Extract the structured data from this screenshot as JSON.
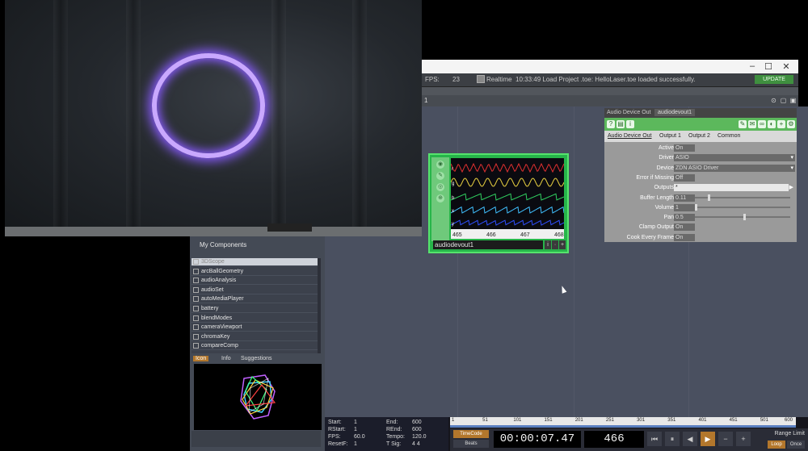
{
  "statusbar": {
    "fps_label": "FPS:",
    "fps_value": "23",
    "realtime_label": "Realtime",
    "message": "10:33:49 Load Project .toe: HelloLaser.toe loaded successfully.",
    "update_label": "UPDATE"
  },
  "window": {
    "minimize": "–",
    "maximize": "☐",
    "close": "✕"
  },
  "pathbar": {
    "label": "1"
  },
  "node": {
    "name": "audiodevout1",
    "ruler": [
      "465",
      "466",
      "467",
      "468"
    ],
    "channel_labels": [
      "r",
      "g",
      "b",
      "x",
      "y"
    ]
  },
  "param": {
    "type_label": "Audio Device Out",
    "name": "audiodevout1",
    "tabs": [
      "Audio Device Out",
      "Output 1",
      "Output 2",
      "Common"
    ],
    "rows": [
      {
        "label": "Active",
        "value": "On"
      },
      {
        "label": "Driver",
        "value": "ASIO"
      },
      {
        "label": "Device",
        "value": "ZDN ASIO Driver"
      },
      {
        "label": "Error if Missing",
        "value": "Off"
      },
      {
        "label": "Outputs",
        "value": "*"
      },
      {
        "label": "Buffer Length",
        "value": "0.11"
      },
      {
        "label": "Volume",
        "value": "1"
      },
      {
        "label": "Pan",
        "value": "0.5"
      },
      {
        "label": "Clamp Output",
        "value": "On"
      },
      {
        "label": "Cook Every Frame",
        "value": "On"
      }
    ]
  },
  "palette": {
    "header": "My Components",
    "items": [
      "3DScope",
      "arcBallGeometry",
      "audioAnalysis",
      "audioSet",
      "autoMediaPlayer",
      "battery",
      "blendModes",
      "cameraViewport",
      "chromaKey",
      "compareComp"
    ],
    "tabs": [
      "Icon",
      "Info",
      "Suggestions"
    ]
  },
  "timeline": {
    "info": {
      "start_label": "Start:",
      "start": "1",
      "end_label": "End:",
      "end": "600",
      "rstart_label": "RStart:",
      "rstart": "1",
      "rend_label": "REnd:",
      "rend": "600",
      "fps_label": "FPS:",
      "fps": "60.0",
      "tempo_label": "Tempo:",
      "tempo": "120.0",
      "resetf_label": "ResetF:",
      "resetf": "1",
      "tsig_label": "T Sig:",
      "tsig": "4    4"
    },
    "ruler": [
      "1",
      "51",
      "101",
      "151",
      "201",
      "251",
      "301",
      "351",
      "401",
      "451",
      "501",
      "600"
    ],
    "timecode_label": "TimeCode",
    "beats_label": "Beats",
    "timecode": "00:00:07.47",
    "frame": "466",
    "range_limit": "Range Limit",
    "loop": "Loop",
    "once": "Once",
    "buttons": [
      "⏮",
      "⏸",
      "◀",
      "▶",
      "−",
      "+"
    ]
  },
  "colors": {
    "laser": "#c9a8ff",
    "node_green": "#27b54a",
    "network_bg": "#4a5060",
    "accent_orange": "#b3772c"
  }
}
